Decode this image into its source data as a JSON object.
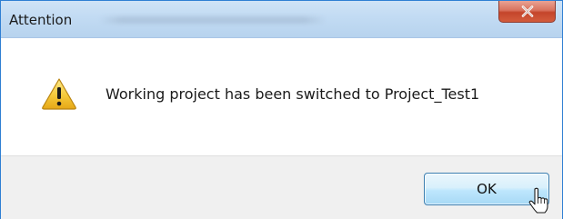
{
  "dialog": {
    "title": "Attention",
    "message": "Working project has been switched to Project_Test1",
    "ok_label": "OK"
  },
  "icons": {
    "close": "close-icon",
    "warning": "warning-icon",
    "cursor": "mouse-pointer-icon"
  },
  "colors": {
    "title_bar": "#c2dbf3",
    "close_button": "#c4452b",
    "warning_yellow": "#f2c230",
    "ok_button": "#bee6fd",
    "footer": "#f0f0f0"
  }
}
